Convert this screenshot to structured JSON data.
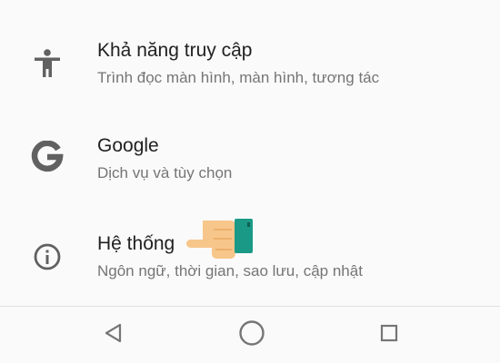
{
  "settings": {
    "items": [
      {
        "id": "accessibility",
        "title": "Khả năng truy cập",
        "subtitle": "Trình đọc màn hình, màn hình, tương tác",
        "icon": "accessibility-icon"
      },
      {
        "id": "google",
        "title": "Google",
        "subtitle": "Dịch vụ và tùy chọn",
        "icon": "google-g-icon"
      },
      {
        "id": "system",
        "title": "Hệ thống",
        "subtitle": "Ngôn ngữ, thời gian, sao lưu, cập nhật",
        "icon": "info-icon"
      }
    ]
  },
  "overlay": {
    "pointer_icon": "pointing-hand-icon",
    "hand_color": "#f7c68a",
    "cuff_color": "#1a9a86"
  },
  "nav_bar": {
    "buttons": [
      {
        "id": "back",
        "icon": "back-triangle-icon"
      },
      {
        "id": "home",
        "icon": "home-circle-icon"
      },
      {
        "id": "recents",
        "icon": "recents-square-icon"
      }
    ]
  },
  "colors": {
    "background": "#fafafa",
    "title_text": "#212121",
    "subtitle_text": "#757575",
    "icon_gray": "#616161",
    "nav_icon_gray": "#757575"
  }
}
